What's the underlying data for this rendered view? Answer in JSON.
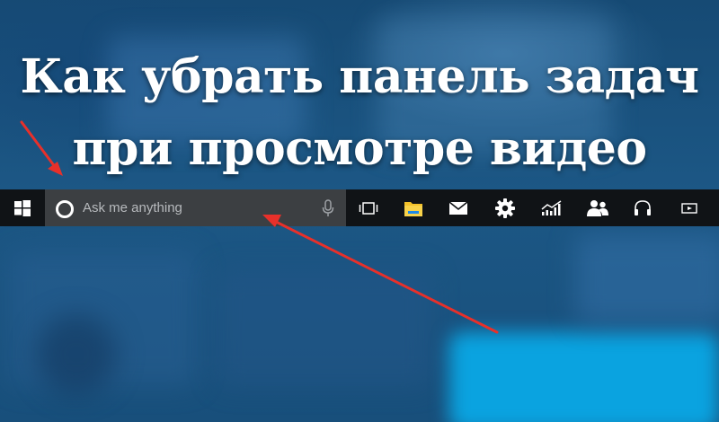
{
  "headline": {
    "line1": "Как убрать панель задач",
    "line2": "при просмотре видео"
  },
  "taskbar": {
    "search_placeholder": "Ask me anything",
    "icons": [
      "windows-start-icon",
      "cortana-icon",
      "microphone-icon",
      "task-view-icon",
      "file-explorer-icon",
      "mail-icon",
      "settings-icon",
      "stats-icon",
      "people-icon",
      "headphones-icon",
      "media-player-icon"
    ]
  },
  "colors": {
    "taskbar": "#101316",
    "search_box": "#3c3f42",
    "arrow": "#e8302a",
    "explorer_folder": "#f3c12a",
    "explorer_band": "#1e88e5"
  }
}
